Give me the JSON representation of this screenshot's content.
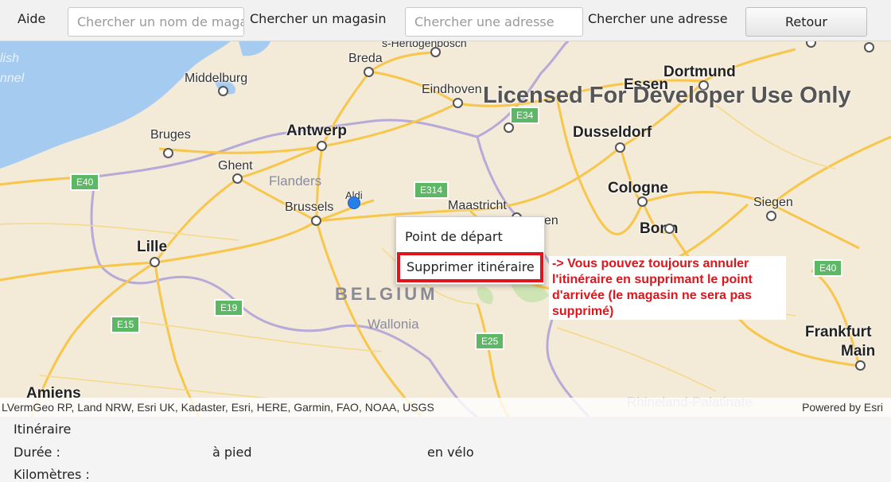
{
  "toolbar": {
    "help_label": "Aide",
    "store_search_placeholder": "Chercher un nom de magasin",
    "store_search_label": "Chercher un magasin",
    "address_search_placeholder": "Chercher une adresse",
    "address_search_label": "Chercher une adresse",
    "back_button": "Retour"
  },
  "map": {
    "watermark": "Licensed For Developer Use Only",
    "cities": [
      {
        "key": "breda",
        "name": "Breda"
      },
      {
        "key": "middelburg",
        "name": "Middelburg"
      },
      {
        "key": "eindhoven",
        "name": "Eindhoven"
      },
      {
        "key": "essen",
        "name": "Essen"
      },
      {
        "key": "dortmund",
        "name": "Dortmund"
      },
      {
        "key": "antwerp",
        "name": "Antwerp"
      },
      {
        "key": "bruges",
        "name": "Bruges"
      },
      {
        "key": "dusseldorf",
        "name": "Dusseldorf"
      },
      {
        "key": "ghent",
        "name": "Ghent"
      },
      {
        "key": "brussels",
        "name": "Brussels"
      },
      {
        "key": "maastricht",
        "name": "Maastricht"
      },
      {
        "key": "cologne",
        "name": "Cologne"
      },
      {
        "key": "siegen",
        "name": "Siegen"
      },
      {
        "key": "bonn",
        "name": "Bonn"
      },
      {
        "key": "lille",
        "name": "Lille"
      },
      {
        "key": "frankfurt",
        "name": "Frankfurt"
      },
      {
        "key": "main",
        "name": "Main"
      },
      {
        "key": "amiens",
        "name": "Amiens"
      },
      {
        "key": "aldi",
        "name": "Aldi"
      },
      {
        "key": "aachen_partial",
        "name": "en"
      },
      {
        "key": "hertogenbosch_partial",
        "name": "s-Hertogenbosch"
      }
    ],
    "regions": [
      {
        "key": "flanders",
        "name": "Flanders"
      },
      {
        "key": "wallonia",
        "name": "Wallonia"
      },
      {
        "key": "rhineland",
        "name": "Rhineland-Palatinate"
      }
    ],
    "country": "BELGIUM",
    "sea_labels": [
      "lish",
      "nnel"
    ],
    "shields": [
      "E34",
      "E40",
      "E314",
      "E40",
      "E19",
      "E15",
      "E25"
    ],
    "attribution_left": "LVermGeo RP, Land NRW, Esri UK, Kadaster, Esri, HERE, Garmin, FAO, NOAA, USGS",
    "attribution_right": "Powered by Esri"
  },
  "context_menu": {
    "items": [
      "Point de départ",
      "Supprimer itinéraire"
    ]
  },
  "annotation": "-> Vous pouvez toujours annuler l'itinéraire en supprimant le point d'arrivée (le magasin ne sera pas supprimé)",
  "itinerary": {
    "title": "Itinéraire",
    "duration_label": "Durée :",
    "walk_label": "à pied",
    "bike_label": "en vélo",
    "km_label": "Kilomètres :"
  },
  "colors": {
    "sea": "#a6cbf0",
    "land": "#f3ead7",
    "road": "#f7c64a",
    "border": "#b7a9d8",
    "shield": "#5cb865",
    "highlight": "#e0151b",
    "marker": "#2a7ee8"
  }
}
